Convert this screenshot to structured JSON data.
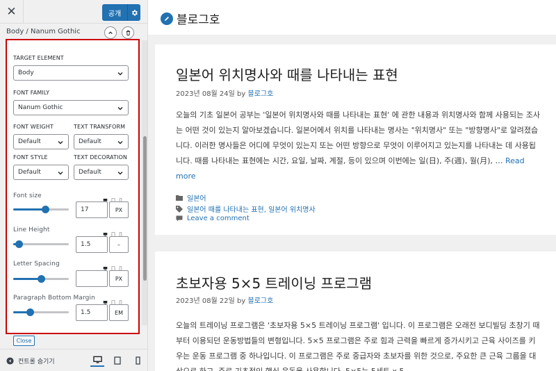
{
  "panel": {
    "publish_label": "공개",
    "section_title": "Body / Nanum Gothic",
    "target_element": {
      "label": "TARGET ELEMENT",
      "value": "Body"
    },
    "font_family": {
      "label": "FONT FAMILY",
      "value": "Nanum Gothic"
    },
    "font_weight": {
      "label": "FONT WEIGHT",
      "value": "Default"
    },
    "text_transform": {
      "label": "TEXT TRANSFORM",
      "value": "Default"
    },
    "font_style": {
      "label": "FONT STYLE",
      "value": "Default"
    },
    "text_decoration": {
      "label": "TEXT DECORATION",
      "value": "Default"
    },
    "font_size": {
      "label": "Font size",
      "value": "17",
      "unit": "PX",
      "slider_fraction": 0.58
    },
    "line_height": {
      "label": "Line Height",
      "value": "1.5",
      "unit": "–",
      "slider_fraction": 0.1
    },
    "letter_spacing": {
      "label": "Letter Spacing",
      "value": "",
      "unit": "PX",
      "slider_fraction": 0.5
    },
    "paragraph_margin": {
      "label": "Paragraph Bottom Margin",
      "value": "1.5",
      "unit": "EM",
      "slider_fraction": 0.3
    },
    "close_label": "Close",
    "hide_controls_label": "컨트롤 숨기기"
  },
  "site": {
    "title": "블로그호"
  },
  "posts": [
    {
      "title": "일본어 위치명사와 때를 나타내는 표현",
      "date": "2023년 08월 24일",
      "by": "by",
      "author": "블로그호",
      "excerpt": "오늘의 기초 일본어 공부는 '일본어 위치명사와 때를 나타내는 표현' 에 관한 내용과 위치명사와 함께 사용되는 조사는 어떤 것이 있는지 알아보겠습니다. 일본어에서 위치를 나타내는 명사는 \"위치명사\" 또는 \"방향명사\"로 알려졌습니다. 이러한 명사들은 어디에 무엇이 있는지 또는 어떤 방향으로 무엇이 이루어지고 있는지를 나타내는 데 사용됩니다. 때를 나타내는 표현에는 시간, 요일, 날짜, 계절, 등이 있으며 이번에는 일(日), 주(週), 월(月), …",
      "read_more": "Read more",
      "category": "일본어",
      "tags": "일본어 때를 나타내는 표현, 일본어 위치명사",
      "comment": "Leave a comment"
    },
    {
      "title": "초보자용 5×5 트레이닝 프로그램",
      "date": "2023년 08월 22일",
      "by": "by",
      "author": "블로그호",
      "excerpt": "오늘의 트레이닝 프로그램은 '초보자용 5×5 트레이닝 프로그램' 입니다. 이 프로그램은 오래전 보디빌딩 초창기 때부터 이용되던 운동방법들의 변형입니다. 5×5 프로그램은 주로 힘과 근력을 빠르게 증가시키고 근육 사이즈를 키우는 운동 프로그램 중 하나입니다. 이 프로그램은 주로 중급자와 초보자를 위한 것으로, 주요한 큰 근육 그룹을 대상으로 하고, 주로 기초적인 핵심 운동을 사용합니다. 5×5는 5세트 x 5"
    }
  ],
  "colors": {
    "accent": "#2271b1",
    "highlight_border": "#cc0000"
  }
}
